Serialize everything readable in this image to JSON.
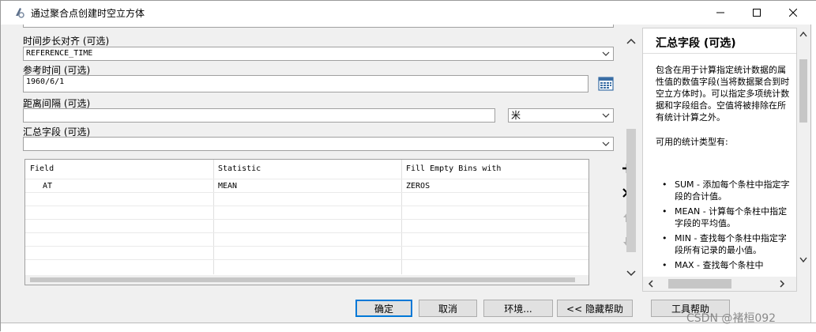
{
  "window": {
    "title": "通过聚合点创建时空立方体"
  },
  "form": {
    "time_step_alignment": {
      "label": "时间步长对齐 (可选)",
      "value": "REFERENCE_TIME"
    },
    "reference_time": {
      "label": "参考时间 (可选)",
      "value": "1960/6/1"
    },
    "distance_interval": {
      "label": "距离间隔 (可选)",
      "value": "",
      "unit": "米"
    },
    "summary_fields": {
      "label": "汇总字段 (可选)",
      "value": "",
      "columns": [
        "Field",
        "Statistic",
        "Fill Empty Bins with"
      ],
      "rows": [
        [
          "AT",
          "MEAN",
          "ZEROS"
        ]
      ]
    }
  },
  "help": {
    "title": "汇总字段 (可选)",
    "intro": "包含在用于计算指定统计数据的属性值的数值字段(当将数据聚合到时空立方体时)。可以指定多项统计数据和字段组合。空值将被排除在所有统计计算之外。",
    "types_heading": "可用的统计类型有:",
    "items": [
      "SUM - 添加每个条柱中指定字段的合计值。",
      "MEAN - 计算每个条柱中指定字段的平均值。",
      "MIN - 查找每个条柱中指定字段所有记录的最小值。",
      "MAX - 查找每个条柱中"
    ]
  },
  "buttons": {
    "ok": "确定",
    "cancel": "取消",
    "environments": "环境...",
    "hide_help": "<< 隐藏帮助",
    "tool_help": "工具帮助"
  },
  "watermark": "CSDN @褚桓092"
}
